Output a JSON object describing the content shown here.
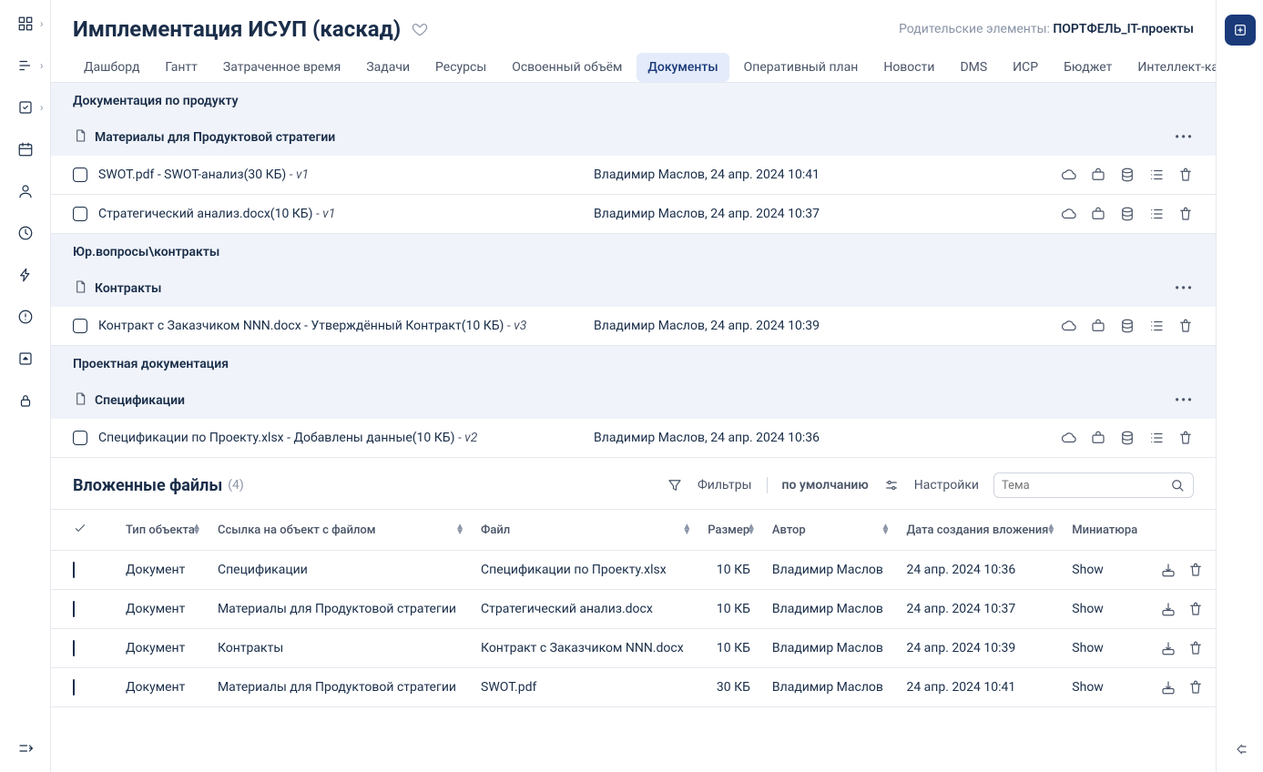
{
  "header": {
    "title": "Имплементация ИСУП (каскад)",
    "parent_label": "Родительские элементы:",
    "parent_value": "ПОРТФЕЛЬ_IT-проекты"
  },
  "tabs": [
    "Дашборд",
    "Гантт",
    "Затраченное время",
    "Задачи",
    "Ресурсы",
    "Освоенный объём",
    "Документы",
    "Оперативный план",
    "Новости",
    "DMS",
    "ИСР",
    "Бюджет",
    "Интеллект-карты"
  ],
  "active_tab": 6,
  "sections": [
    {
      "title": "Документация по продукту",
      "folders": [
        {
          "name": "Материалы для Продуктовой стратегии",
          "files": [
            {
              "name": "SWOT.pdf",
              "desc": "SWOT-анализ",
              "size": "30 КБ",
              "version": "v1",
              "meta": "Владимир Маслов, 24 апр. 2024 10:41"
            },
            {
              "name": "Стратегический анализ.docx",
              "desc": "",
              "size": "10 КБ",
              "version": "v1",
              "meta": "Владимир Маслов, 24 апр. 2024 10:37"
            }
          ]
        }
      ]
    },
    {
      "title": "Юр.вопросы\\контракты",
      "folders": [
        {
          "name": "Контракты",
          "files": [
            {
              "name": "Контракт с Заказчиком NNN.docx",
              "desc": "Утверждённый Контракт",
              "size": "10 КБ",
              "version": "v3",
              "meta": "Владимир Маслов, 24 апр. 2024 10:39"
            }
          ]
        }
      ]
    },
    {
      "title": "Проектная документация",
      "folders": [
        {
          "name": "Спецификации",
          "files": [
            {
              "name": "Спецификации по Проекту.xlsx",
              "desc": "Добавлены данные",
              "size": "10 КБ",
              "version": "v2",
              "meta": "Владимир Маслов, 24 апр. 2024 10:36"
            }
          ]
        }
      ]
    }
  ],
  "attach": {
    "title": "Вложенные файлы",
    "count": "(4)",
    "filters_label": "Фильтры",
    "default_label": "по умолчанию",
    "settings_label": "Настройки",
    "search_placeholder": "Тема"
  },
  "columns": [
    "Тип объекта",
    "Ссылка на объект с файлом",
    "Файл",
    "Размер",
    "Автор",
    "Дата создания вложения",
    "Миниатюра"
  ],
  "rows": [
    {
      "type": "Документ",
      "link": "Спецификации",
      "file": "Спецификации по Проекту.xlsx",
      "size": "10 КБ",
      "author": "Владимир Маслов",
      "date": "24 апр. 2024 10:36",
      "thumb": "Show"
    },
    {
      "type": "Документ",
      "link": "Материалы для Продуктовой стратегии",
      "file": "Стратегический анализ.docx",
      "size": "10 КБ",
      "author": "Владимир Маслов",
      "date": "24 апр. 2024 10:37",
      "thumb": "Show"
    },
    {
      "type": "Документ",
      "link": "Контракты",
      "file": "Контракт с Заказчиком NNN.docx",
      "size": "10 КБ",
      "author": "Владимир Маслов",
      "date": "24 апр. 2024 10:39",
      "thumb": "Show"
    },
    {
      "type": "Документ",
      "link": "Материалы для Продуктовой стратегии",
      "file": "SWOT.pdf",
      "size": "30 КБ",
      "author": "Владимир Маслов",
      "date": "24 апр. 2024 10:41",
      "thumb": "Show"
    }
  ]
}
